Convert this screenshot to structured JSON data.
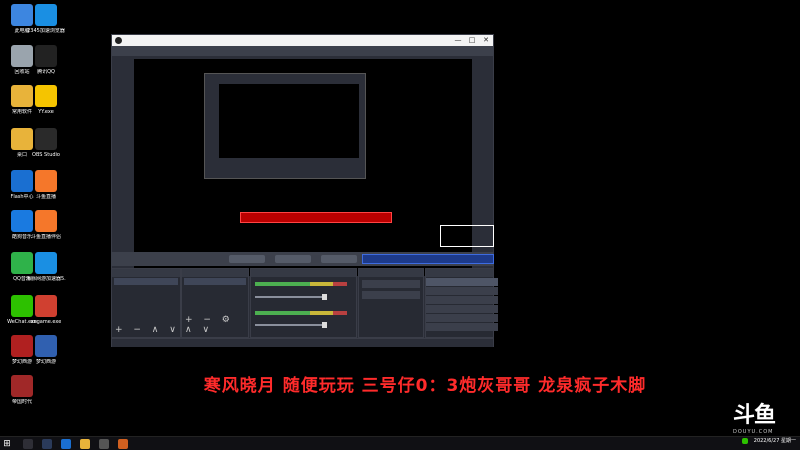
{
  "desktop_icons": [
    {
      "label": "此电脑",
      "icon": "computer-icon",
      "color": "#3d86e0"
    },
    {
      "label": "2345加速浏览器",
      "icon": "browser-icon",
      "color": "#1a8fe3"
    },
    {
      "label": "回收站",
      "icon": "recycle-bin-icon",
      "color": "#9aa4ad"
    },
    {
      "label": "腾讯QQ",
      "icon": "qq-icon",
      "color": "#222222"
    },
    {
      "label": "常用软件",
      "icon": "folder-icon",
      "color": "#e8b33a"
    },
    {
      "label": "YY.exe",
      "icon": "yy-icon",
      "color": "#f5c400"
    },
    {
      "label": "桌口",
      "icon": "folder-icon",
      "color": "#e8b33a"
    },
    {
      "label": "OBS Studio",
      "icon": "obs-icon",
      "color": "#2a2a2a"
    },
    {
      "label": "Flash中心",
      "icon": "flash-icon",
      "color": "#1a6fd1"
    },
    {
      "label": "斗鱼直播",
      "icon": "douyu-icon",
      "color": "#f5772a"
    },
    {
      "label": "酷狗音乐",
      "icon": "kugou-icon",
      "color": "#1a7ae0"
    },
    {
      "label": "斗鱼直播伴侣",
      "icon": "douyu-companion-icon",
      "color": "#f5772a"
    },
    {
      "label": "QQ音乐",
      "icon": "qq-music-icon",
      "color": "#2fb24a"
    },
    {
      "label": "海豚网游加速器5.0",
      "icon": "accelerator-icon",
      "color": "#1a8fe3"
    },
    {
      "label": "WeChat.exe",
      "icon": "wechat-icon",
      "color": "#2dc100"
    },
    {
      "label": "cngame.exe",
      "icon": "game-icon",
      "color": "#d04030"
    },
    {
      "label": "梦幻西游",
      "icon": "game-icon",
      "color": "#b02020"
    },
    {
      "label": "梦幻西游",
      "icon": "game-icon",
      "color": "#3060b0"
    },
    {
      "label": "帝国时代",
      "icon": "game-icon",
      "color": "#a02828"
    }
  ],
  "obs": {
    "window_buttons": [
      "—",
      "□",
      "✕"
    ]
  },
  "overlay_caption": "寒风晓月 随便玩玩 三号仔0：3炮灰哥哥 龙泉疯子木脚",
  "douyu_logo": "斗鱼",
  "douyu_logo_sub": "DOUYU.COM",
  "taskbar": {
    "clock_date": "2022/6/27 星期一"
  },
  "colors": {
    "caption": "#ff2b2b",
    "obs_bg": "#2b2e38",
    "danmaku_text": "#dddddd",
    "highlight_bar": "#1d3a8a"
  }
}
